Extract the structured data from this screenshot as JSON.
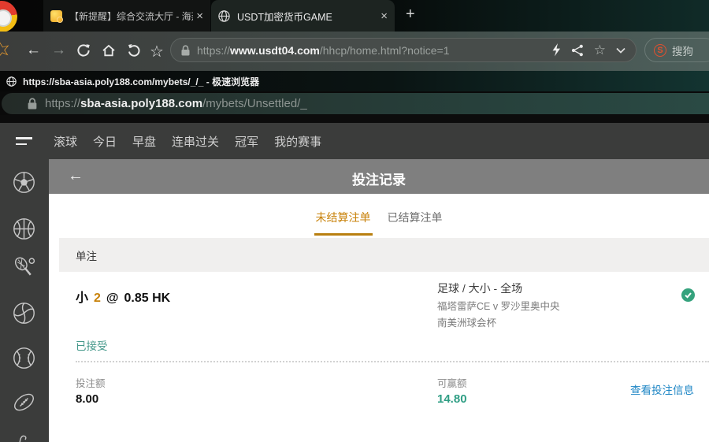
{
  "colors": {
    "accent_orange": "#c8820a",
    "win_teal": "#2f9e84",
    "status_teal": "#46998b",
    "check_green": "#35a27d",
    "link_blue": "#1e86c5",
    "sogou_red": "#e2502e",
    "header_gray": "#7f7f7f",
    "dark_chrome": "#3b3c3b"
  },
  "icons": {
    "close": "×",
    "back_arrow": "←",
    "forward_arrow": "→",
    "star": "☆",
    "new_tab": "+",
    "edge_star": "☆"
  },
  "browser": {
    "tabs": [
      {
        "title": "【新提醒】综合交流大厅 - 海燕策"
      },
      {
        "title": "USDT加密货币GAME"
      }
    ],
    "url_protocol": "https://",
    "url_host": "www.usdt04.com",
    "url_path": "/hhcp/home.html?notice=1",
    "search_logo": "S",
    "search_label": "搜狗"
  },
  "popup": {
    "window_title": "https://sba-asia.poly188.com/mybets/_/_ - 极速浏览器",
    "url_protocol": "https://",
    "url_host": "sba-asia.poly188.com",
    "url_path": "/mybets/Unsettled/_"
  },
  "nav": {
    "items": [
      "滚球",
      "今日",
      "早盘",
      "连串过关",
      "冠军",
      "我的赛事"
    ]
  },
  "sidebar": {
    "sports": [
      "soccer",
      "basketball",
      "tennis",
      "volleyball",
      "baseball",
      "american-football",
      "golf-partial"
    ]
  },
  "page": {
    "back": "←",
    "title": "投注记录",
    "tab_unsettled": "未结算注单",
    "tab_settled": "已结算注单",
    "section_label": "单注",
    "bet": {
      "pick": "小",
      "handicap": "2",
      "at_sign": "@",
      "odds": "0.85 HK",
      "market": "足球 / 大小 - 全场",
      "match": "福塔雷萨CE v 罗沙里奥中央",
      "league": "南美洲球会杯",
      "status": "已接受",
      "stake_label": "投注额",
      "stake_value": "8.00",
      "win_label": "可赢额",
      "win_value": "14.80",
      "details_link": "查看投注信息"
    }
  }
}
